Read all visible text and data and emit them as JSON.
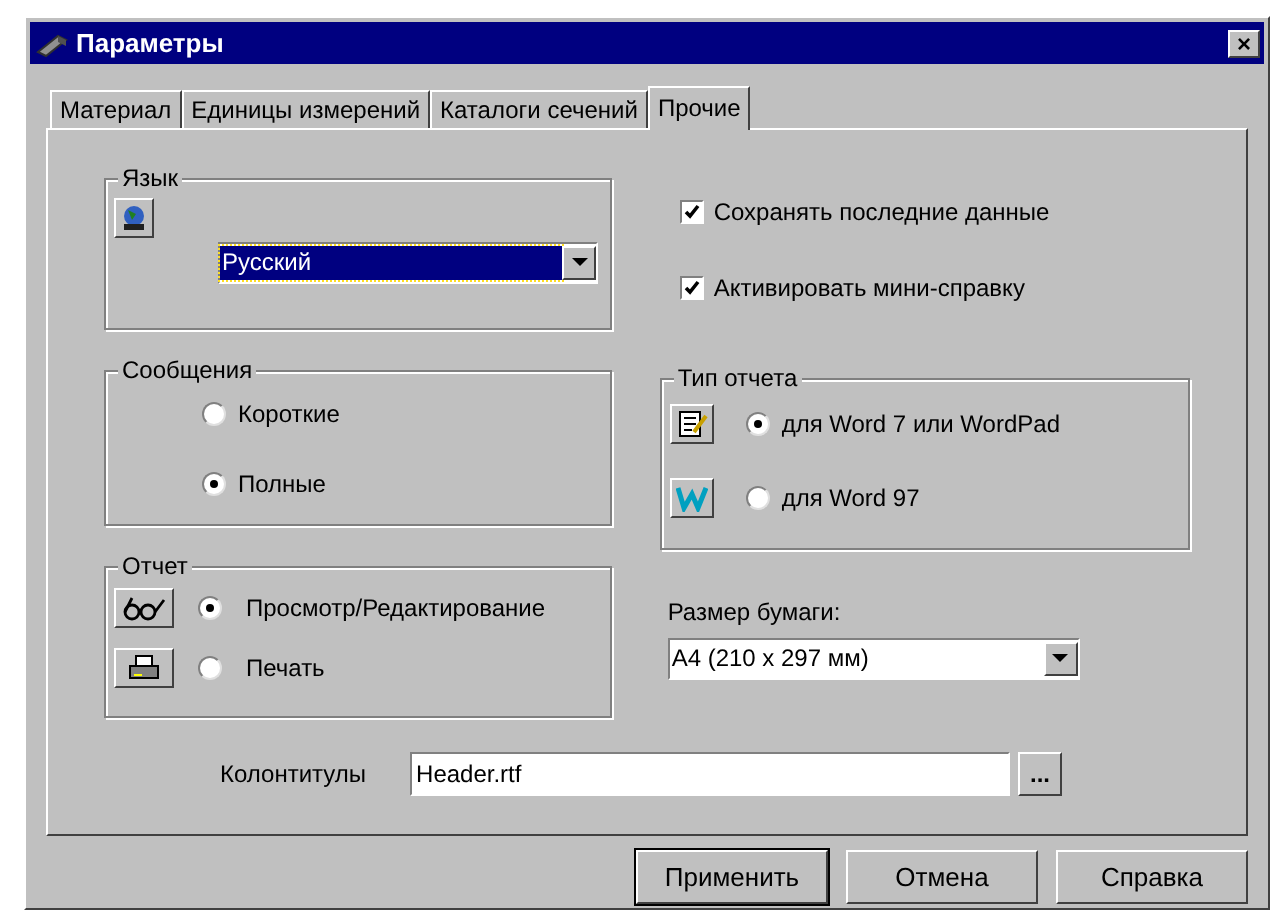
{
  "window": {
    "title": "Параметры",
    "close": "×"
  },
  "tabs": [
    {
      "label": "Материал",
      "selected": false
    },
    {
      "label": "Единицы измерений",
      "selected": false
    },
    {
      "label": "Каталоги сечений",
      "selected": false
    },
    {
      "label": "Прочие",
      "selected": true
    }
  ],
  "language": {
    "title": "Язык",
    "value": "Русский"
  },
  "messages": {
    "title": "Сообщения",
    "options": [
      {
        "label": "Короткие",
        "selected": false
      },
      {
        "label": "Полные",
        "selected": true
      }
    ]
  },
  "report": {
    "title": "Отчет",
    "options": [
      {
        "label": "Просмотр/Редактирование",
        "selected": true,
        "kind": "view"
      },
      {
        "label": "Печать",
        "selected": false,
        "kind": "print"
      }
    ]
  },
  "checkboxes": [
    {
      "label": "Сохранять последние данные",
      "checked": true
    },
    {
      "label": "Активировать мини-справку",
      "checked": true
    }
  ],
  "report_type": {
    "title": "Тип отчета",
    "options": [
      {
        "label": "для Word 7 или WordPad",
        "selected": true,
        "kind": "wordpad"
      },
      {
        "label": "для Word 97",
        "selected": false,
        "kind": "word"
      }
    ]
  },
  "paper": {
    "label": "Размер бумаги:",
    "value": "A4 (210 x 297 мм)"
  },
  "headers": {
    "label": "Колонтитулы",
    "value": "Header.rtf",
    "browse": "..."
  },
  "buttons": [
    {
      "label": "Применить",
      "default": true
    },
    {
      "label": "Отмена",
      "default": false
    },
    {
      "label": "Справка",
      "default": false
    }
  ]
}
